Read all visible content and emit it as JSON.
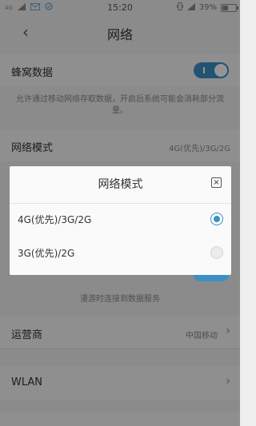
{
  "status_bar": {
    "time": "15:20",
    "network_type": "4G",
    "battery": "39%",
    "battery_level": 0.39,
    "icons": [
      "signal-icon",
      "sms-icon",
      "notification-icon",
      "vibrate-icon",
      "wifi-icon",
      "battery-icon"
    ]
  },
  "header": {
    "title": "网络",
    "back_glyph": "‹"
  },
  "settings": {
    "cellular_data": {
      "label": "蜂窝数据",
      "enabled": true
    },
    "cellular_desc": "允许通过移动网络存取数据，开启后系统可能会消耗部分流量。",
    "network_mode": {
      "label": "网络模式",
      "value": "4G(优先)/3G/2G",
      "chevron": "›"
    },
    "roaming_desc": "漫游时连接到数据服务",
    "carrier": {
      "label": "运营商",
      "value": "中国移动",
      "chevron": "›"
    },
    "wlan": {
      "label": "WLAN",
      "chevron": "›"
    }
  },
  "dialog": {
    "title": "网络模式",
    "close_glyph": "×",
    "options": [
      {
        "label": "4G(优先)/3G/2G",
        "selected": true
      },
      {
        "label": "3G(优先)/2G",
        "selected": false
      }
    ]
  },
  "colors": {
    "accent": "#3d8fc4",
    "background": "#efefef",
    "overlay": "rgba(0,0,0,0.42)"
  }
}
